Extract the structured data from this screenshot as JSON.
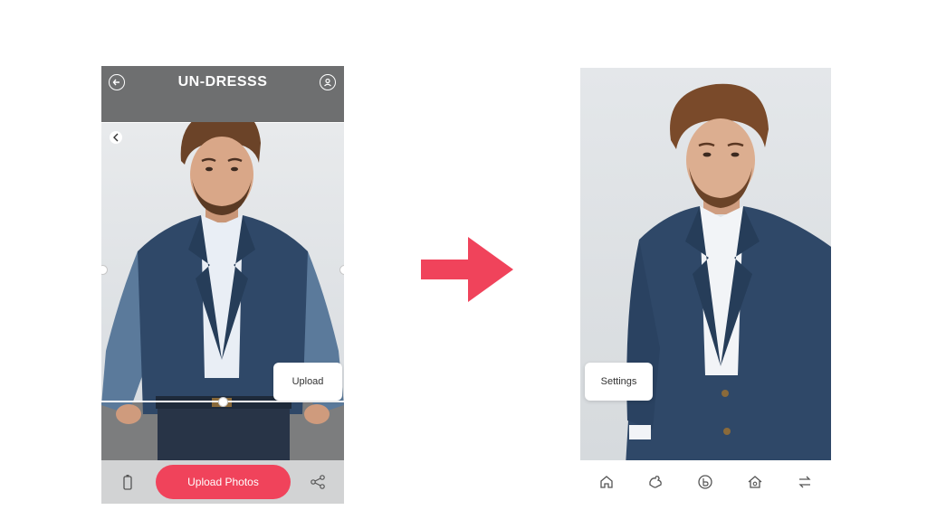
{
  "left_app": {
    "header": {
      "title": "UN-DRESSS",
      "back_icon": "back-arrow-icon",
      "profile_icon": "user-icon"
    },
    "crop_back_icon": "chevron-left-icon",
    "upload_card_label": "Upload",
    "upload_photos_button": "Upload Photos",
    "bottom_icons": [
      "battery-icon",
      "share-icon"
    ]
  },
  "transition_arrow": {
    "icon": "right-arrow-icon",
    "color": "#f0435b"
  },
  "right_app": {
    "settings_card_label": "Settings",
    "nav_items": [
      "home-icon",
      "puzzle-icon",
      "b-circle-icon",
      "house-icon",
      "swap-icon"
    ]
  },
  "colors": {
    "accent": "#f0435b",
    "header_gray": "#6e6f70",
    "bottom_bar_gray": "#d2d3d4",
    "suit_navy": "#2f4868",
    "shirt": "#e9eef5"
  }
}
